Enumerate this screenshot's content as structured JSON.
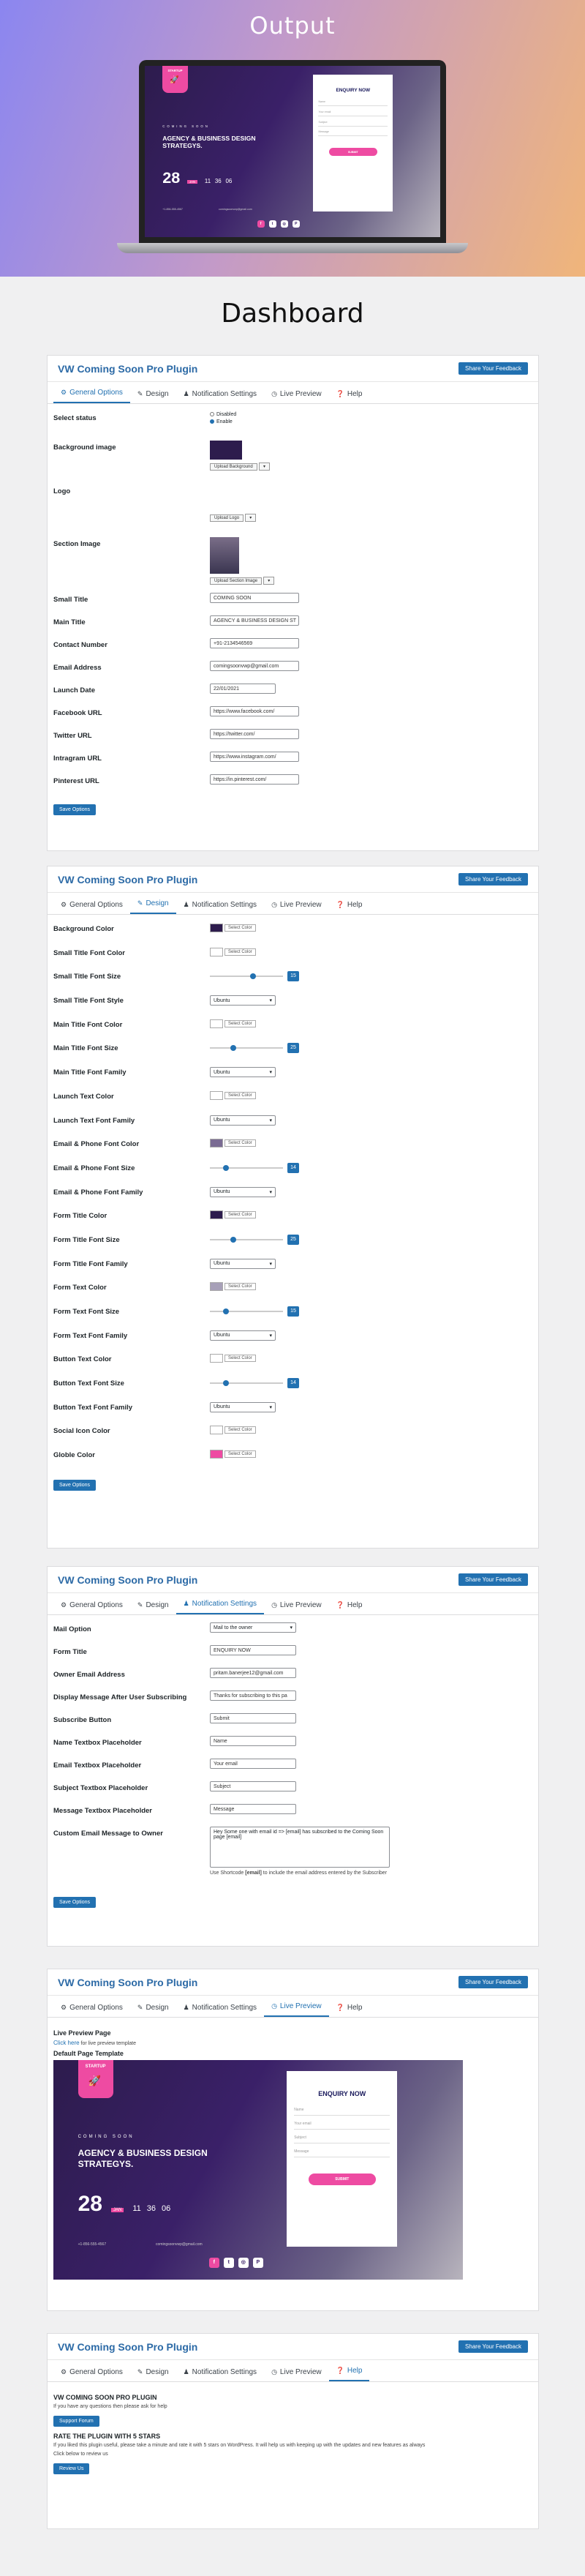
{
  "hero": {
    "title": "Output"
  },
  "dashboard_title": "Dashboard",
  "plugin_title": "VW Coming Soon Pro Plugin",
  "feedback_label": "Share Your Feedback",
  "tabs": [
    {
      "label": "General Options",
      "icon": "gear-icon"
    },
    {
      "label": "Design",
      "icon": "brush-icon"
    },
    {
      "label": "Notification Settings",
      "icon": "user-icon"
    },
    {
      "label": "Live Preview",
      "icon": "clock-icon"
    },
    {
      "label": "Help",
      "icon": "help-icon"
    }
  ],
  "save_label": "Save Options",
  "general": {
    "select_status": "Select status",
    "disabled": "Disabled",
    "enable": "Enable",
    "background_image": "Background image",
    "upload_background": "Upload Background",
    "logo": "Logo",
    "upload_logo": "Upload Logo",
    "section_image": "Section Image",
    "upload_section_image": "Upload Section Image",
    "fields": [
      {
        "label": "Small Title",
        "value": "COMING SOON"
      },
      {
        "label": "Main Title",
        "value": "AGENCY & BUSINESS DESIGN ST"
      },
      {
        "label": "Contact Number",
        "value": "+91-2134546569"
      },
      {
        "label": "Email Address",
        "value": "comingsoonvwp@gmail.com"
      },
      {
        "label": "Launch Date",
        "value": "22/01/2021"
      },
      {
        "label": "Facebook URL",
        "value": "https://www.facebook.com/"
      },
      {
        "label": "Twitter URL",
        "value": "https://twitter.com/"
      },
      {
        "label": "Intragram URL",
        "value": "https://www.instagram.com/"
      },
      {
        "label": "Pinterest URL",
        "value": "https://in.pinterest.com/"
      }
    ]
  },
  "design": {
    "select_color": "Select Color",
    "font_option": "Ubuntu",
    "rows": [
      {
        "label": "Background Color",
        "kind": "color",
        "color": "#2d1c4d"
      },
      {
        "label": "Small Title Font Color",
        "kind": "color",
        "color": "#ffffff"
      },
      {
        "label": "Small Title Font Size",
        "kind": "slider",
        "value": "15",
        "level": 0.6
      },
      {
        "label": "Small Title Font Style",
        "kind": "select"
      },
      {
        "label": "Main Title Font Color",
        "kind": "color",
        "color": "#ffffff"
      },
      {
        "label": "Main Title Font Size",
        "kind": "slider",
        "value": "25",
        "level": 0.3
      },
      {
        "label": "Main Title Font Family",
        "kind": "select"
      },
      {
        "label": "Launch Text Color",
        "kind": "color",
        "color": "#ffffff"
      },
      {
        "label": "Launch Text Font Family",
        "kind": "select"
      },
      {
        "label": "Email & Phone Font Color",
        "kind": "color",
        "color": "#7a6b93"
      },
      {
        "label": "Email & Phone Font Size",
        "kind": "slider",
        "value": "14",
        "level": 0.2
      },
      {
        "label": "Email & Phone Font Family",
        "kind": "select"
      },
      {
        "label": "Form Title Color",
        "kind": "color",
        "color": "#2d1c4d"
      },
      {
        "label": "Form Title Font Size",
        "kind": "slider",
        "value": "25",
        "level": 0.3
      },
      {
        "label": "Form Title Font Family",
        "kind": "select"
      },
      {
        "label": "Form Text Color",
        "kind": "color",
        "color": "#a7a0b8"
      },
      {
        "label": "Form Text Font Size",
        "kind": "slider",
        "value": "15",
        "level": 0.2
      },
      {
        "label": "Form Text Font Family",
        "kind": "select"
      },
      {
        "label": "Button Text Color",
        "kind": "color",
        "color": "#ffffff"
      },
      {
        "label": "Button Text Font Size",
        "kind": "slider",
        "value": "14",
        "level": 0.2
      },
      {
        "label": "Button Text Font Family",
        "kind": "select"
      },
      {
        "label": "Social Icon Color",
        "kind": "color",
        "color": "#ffffff"
      },
      {
        "label": "Globle Color",
        "kind": "color",
        "color": "#ee4ba2"
      }
    ]
  },
  "notification": {
    "mail_option_label": "Mail Option",
    "mail_option_value": "Mail to the owner",
    "fields": [
      {
        "label": "Form Title",
        "value": "ENQUIRY NOW"
      },
      {
        "label": "Owner Email Address",
        "value": "pritam.banerjee12@gmail.com"
      },
      {
        "label": "Display Message After User Subscribing",
        "value": "Thanks for subscribing to this pa"
      },
      {
        "label": "Subscribe Button",
        "value": "Submit"
      },
      {
        "label": "Name Textbox Placeholder",
        "value": "Name"
      },
      {
        "label": "Email Textbox Placeholder",
        "value": "Your email"
      },
      {
        "label": "Subject Textbox Placeholder",
        "value": "Subject"
      },
      {
        "label": "Message Textbox Placeholder",
        "value": "Message"
      }
    ],
    "custom_label": "Custom Email Message to Owner",
    "custom_value": "Hey Some one with email id => [email] has subscribed to the Coming Soon page [email]",
    "hint_pre": "Use Shortcode ",
    "hint_code": "[email]",
    "hint_post": " to include the email address entered by the Subscriber"
  },
  "live": {
    "heading": "Live Preview Page",
    "click_here": "Click here",
    "click_rest": " for live preview template",
    "default_template": "Default Page Template"
  },
  "preview": {
    "badge": "STARTUP",
    "small_title": "COMING SOON",
    "main_title_1": "AGENCY & BUSINESS DESIGN",
    "main_title_2": "STRATEGYS.",
    "day": "28",
    "month": "JAN",
    "h": "11",
    "m": "36",
    "s": "06",
    "phone": "+1-856-555-4567",
    "email": "comingsoonvwp@gmail.com",
    "form_title": "ENQUIRY NOW",
    "name": "Name",
    "your_email": "Your email",
    "subject": "Subject",
    "message": "Message",
    "submit": "SUBMIT",
    "social": [
      "f",
      "t",
      "◎",
      "P"
    ]
  },
  "help": {
    "title": "VW COMING SOON PRO PLUGIN",
    "p1": "If you have any questions then please ask for help",
    "support": "Support Forum",
    "rate_title": "RATE THE PLUGIN WITH 5 STARS",
    "p2": "If you liked this plugin useful, please take a minute and rate it with 5 stars on WordPress. It will help us with keeping up with the updates and new features as always",
    "p3": "Click below to review us",
    "review": "Review Us"
  }
}
